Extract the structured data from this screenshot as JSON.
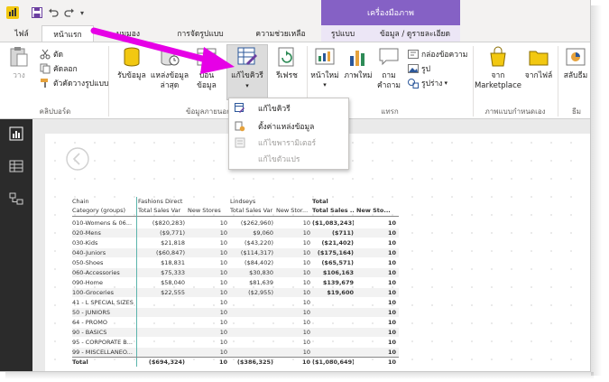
{
  "quick_access": {
    "save": "save-icon",
    "undo": "undo-icon",
    "redo": "redo-icon",
    "customize": "▾"
  },
  "contextual_title": "เครื่องมือภาพ",
  "tabs": [
    {
      "label": "ไฟล์"
    },
    {
      "label": "หน้าแรก"
    },
    {
      "label": "มุมมอง"
    },
    {
      "label": "การจัดรูปแบบ"
    },
    {
      "label": "ความช่วยเหลือ"
    },
    {
      "label": "รูปแบบ"
    },
    {
      "label": "ข้อมูล / ดูรายละเอียด"
    }
  ],
  "ribbon": {
    "clipboard": {
      "paste": "วาง",
      "cut": "ตัด",
      "copy": "คัดลอก",
      "format_painter": "ตัวคัดวางรูปแบบ",
      "group_label": "คลิปบอร์ด"
    },
    "external_data": {
      "get_data": "รับข้อมูล",
      "recent_sources": "แหล่งข้อมูลล่าสุด",
      "enter_data": "ป้อนข้อมูล",
      "edit_queries": "แก้ไขคิวรี",
      "refresh": "รีเฟรช",
      "group_label": "ข้อมูลภายนอก"
    },
    "insert": {
      "new_page": "หน้าใหม่",
      "new_visual": "ภาพใหม่",
      "ask_question": "ถามคำถาม",
      "text_box": "กล่องข้อความ",
      "image": "รูป",
      "shapes": "รูปร่าง",
      "group_label": "แทรก"
    },
    "custom_visuals": {
      "from_marketplace": "จาก Marketplace",
      "from_file": "จากไฟล์",
      "group_label": "ภาพแบบกำหนดเอง"
    },
    "themes": {
      "switch_theme": "สลับธีม",
      "group_label": "ธีม"
    }
  },
  "dropdown": [
    {
      "label": "แก้ไขคิวรี",
      "enabled": true
    },
    {
      "label": "ตั้งค่าแหล่งข้อมูล",
      "enabled": true
    },
    {
      "label": "แก้ไขพารามิเตอร์",
      "enabled": false
    },
    {
      "label": "แก้ไขตัวแปร",
      "enabled": false
    }
  ],
  "left_nav": [
    "report-icon",
    "data-icon",
    "relationships-icon"
  ],
  "matrix": {
    "header1": [
      "Chain",
      "Fashions Direct",
      "",
      "Lindseys",
      "",
      "Total",
      ""
    ],
    "header2": [
      "Category (groups)",
      "Total Sales Var",
      "New Stores",
      "Total Sales Var",
      "New Stor...",
      "Total Sales ...",
      "New Sto..."
    ],
    "rows": [
      [
        "010-Womens & 06...",
        "($820,283)",
        "10",
        "($262,960)",
        "10",
        "($1,083,243)",
        "10"
      ],
      [
        "020-Mens",
        "($9,771)",
        "10",
        "$9,060",
        "10",
        "($711)",
        "10"
      ],
      [
        "030-Kids",
        "$21,818",
        "10",
        "($43,220)",
        "10",
        "($21,402)",
        "10"
      ],
      [
        "040-Juniors",
        "($60,847)",
        "10",
        "($114,317)",
        "10",
        "($175,164)",
        "10"
      ],
      [
        "050-Shoes",
        "$18,831",
        "10",
        "($84,402)",
        "10",
        "($65,571)",
        "10"
      ],
      [
        "060-Accessories",
        "$75,333",
        "10",
        "$30,830",
        "10",
        "$106,163",
        "10"
      ],
      [
        "090-Home",
        "$58,040",
        "10",
        "$81,639",
        "10",
        "$139,679",
        "10"
      ],
      [
        "100-Groceries",
        "$22,555",
        "10",
        "($2,955)",
        "10",
        "$19,600",
        "10"
      ],
      [
        "41 - L SPECIAL SIZES",
        "",
        "10",
        "",
        "10",
        "",
        "10"
      ],
      [
        "50 - JUNIORS",
        "",
        "10",
        "",
        "10",
        "",
        "10"
      ],
      [
        "64 - PROMO",
        "",
        "10",
        "",
        "10",
        "",
        "10"
      ],
      [
        "90 - BASICS",
        "",
        "10",
        "",
        "10",
        "",
        "10"
      ],
      [
        "95 - CORPORATE B...",
        "",
        "10",
        "",
        "10",
        "",
        "10"
      ],
      [
        "99 - MISCELLANEO...",
        "",
        "10",
        "",
        "10",
        "",
        "10"
      ],
      [
        "Total",
        "($694,324)",
        "10",
        "($386,325)",
        "10",
        "($1,080,649)",
        "10"
      ]
    ]
  },
  "colors": {
    "accent": "#8561c5",
    "file_tab": "#f3f2f1",
    "arrow": "#e600e6",
    "left_nav": "#2b2b2b"
  }
}
